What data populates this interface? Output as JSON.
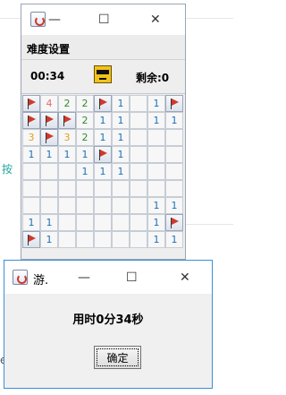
{
  "background": {
    "fragment_1": "按",
    "fragment_2": "e"
  },
  "game_window": {
    "title_suffix": "—",
    "controls": {
      "minimize": "—",
      "maximize": "☐",
      "close": "✕"
    },
    "menu": {
      "item": "难度设置"
    },
    "status": {
      "timer": "00:34",
      "remaining": "剩余:0"
    },
    "board": [
      [
        "F",
        "4",
        "2",
        "2",
        "F",
        "1",
        "",
        "1",
        "F"
      ],
      [
        "F",
        "F",
        "F",
        "2",
        "1",
        "1",
        "",
        "1",
        "1"
      ],
      [
        "3",
        "F",
        "3",
        "2",
        "1",
        "1",
        "",
        "",
        ""
      ],
      [
        "1",
        "1",
        "1",
        "1",
        "F",
        "1",
        "",
        "",
        ""
      ],
      [
        "",
        "",
        "",
        "1",
        "1",
        "1",
        "",
        "",
        ""
      ],
      [
        "",
        "",
        "",
        "",
        "",
        "",
        "",
        "",
        ""
      ],
      [
        "",
        "",
        "",
        "",
        "",
        "",
        "",
        "1",
        "1"
      ],
      [
        "1",
        "1",
        "",
        "",
        "",
        "",
        "",
        "1",
        "F"
      ],
      [
        "F",
        "1",
        "",
        "",
        "",
        "",
        "",
        "1",
        "1"
      ]
    ]
  },
  "dialog": {
    "title": "游.",
    "controls": {
      "minimize": "—",
      "maximize": "☐",
      "close": "✕"
    },
    "message": "用时0分34秒",
    "ok_label": "确定"
  }
}
